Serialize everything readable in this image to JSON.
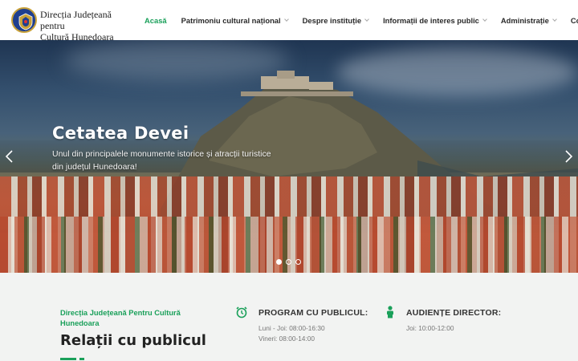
{
  "header": {
    "brand_line1": "Direcția Județeană pentru",
    "brand_line2": "Cultură Hunedoara",
    "nav": [
      {
        "label": "Acasă",
        "active": true,
        "dropdown": false
      },
      {
        "label": "Patrimoniu cultural național",
        "active": false,
        "dropdown": true
      },
      {
        "label": "Despre instituție",
        "active": false,
        "dropdown": true
      },
      {
        "label": "Informații de interes public",
        "active": false,
        "dropdown": true
      },
      {
        "label": "Administrație",
        "active": false,
        "dropdown": true
      },
      {
        "label": "Contact",
        "active": false,
        "dropdown": false
      }
    ]
  },
  "hero": {
    "title": "Cetatea Devei",
    "subtitle": "Unul din principalele monumente istorice și atracții turistice din județul Hunedoara!",
    "slide_count": 3,
    "active_slide": 1
  },
  "contact": {
    "org": "Direcția Județeană Pentru Cultură Hunedoara",
    "title": "Relații cu publicul",
    "program": {
      "title": "PROGRAM CU PUBLICUL:",
      "line1": "Luni - Joi: 08:00-16:30",
      "line2": "Vineri: 08:00-14:00"
    },
    "audiente": {
      "title": "AUDIENȚE DIRECTOR:",
      "line1": "Joi: 10:00-12:00"
    }
  },
  "colors": {
    "accent": "#1aa05a",
    "text": "#222222",
    "section_bg": "#f2f3f2"
  },
  "icons": {
    "logo": "coat-of-arms-icon",
    "program": "alarm-clock-icon",
    "audiente": "person-icon",
    "prev": "chevron-left-icon",
    "next": "chevron-right-icon"
  }
}
